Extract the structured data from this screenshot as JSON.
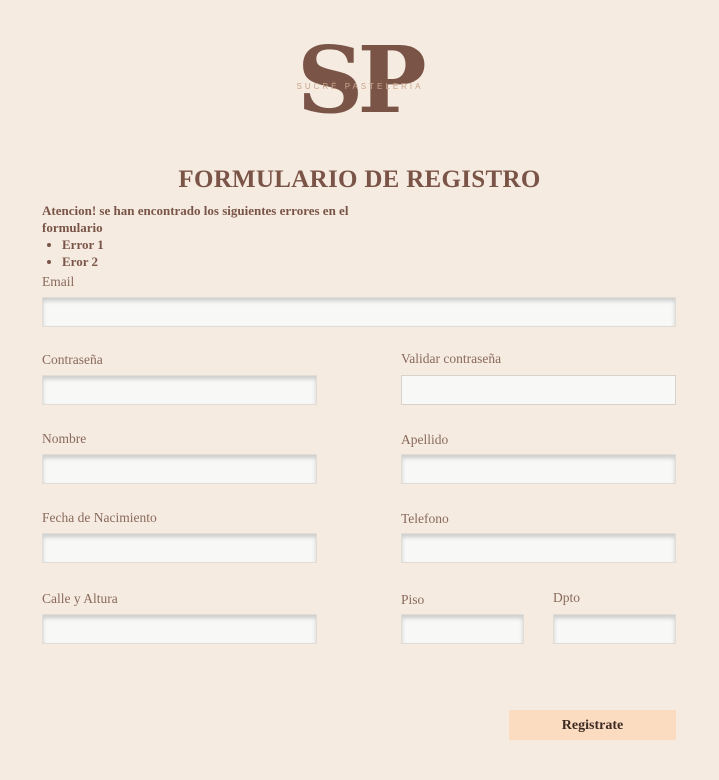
{
  "logo": {
    "letters": "SP",
    "subtitle": "SUCRÉ PASTELERIA"
  },
  "form": {
    "title": "FORMULARIO DE REGISTRO",
    "error_message": "Atencion! se han encontrado los siguientes errores en el formulario",
    "errors": [
      "Error 1",
      "Eror 2"
    ],
    "fields": {
      "email": {
        "label": "Email",
        "value": ""
      },
      "password": {
        "label": "Contraseña",
        "value": ""
      },
      "confirm_password": {
        "label": "Validar contraseña",
        "value": ""
      },
      "first_name": {
        "label": "Nombre",
        "value": ""
      },
      "last_name": {
        "label": "Apellido",
        "value": ""
      },
      "birth_date": {
        "label": "Fecha de Nacimiento",
        "value": ""
      },
      "phone": {
        "label": "Telefono",
        "value": ""
      },
      "street": {
        "label": "Calle y Altura",
        "value": ""
      },
      "floor": {
        "label": "Piso",
        "value": ""
      },
      "apartment": {
        "label": "Dpto",
        "value": ""
      }
    },
    "submit_label": "Registrate"
  }
}
